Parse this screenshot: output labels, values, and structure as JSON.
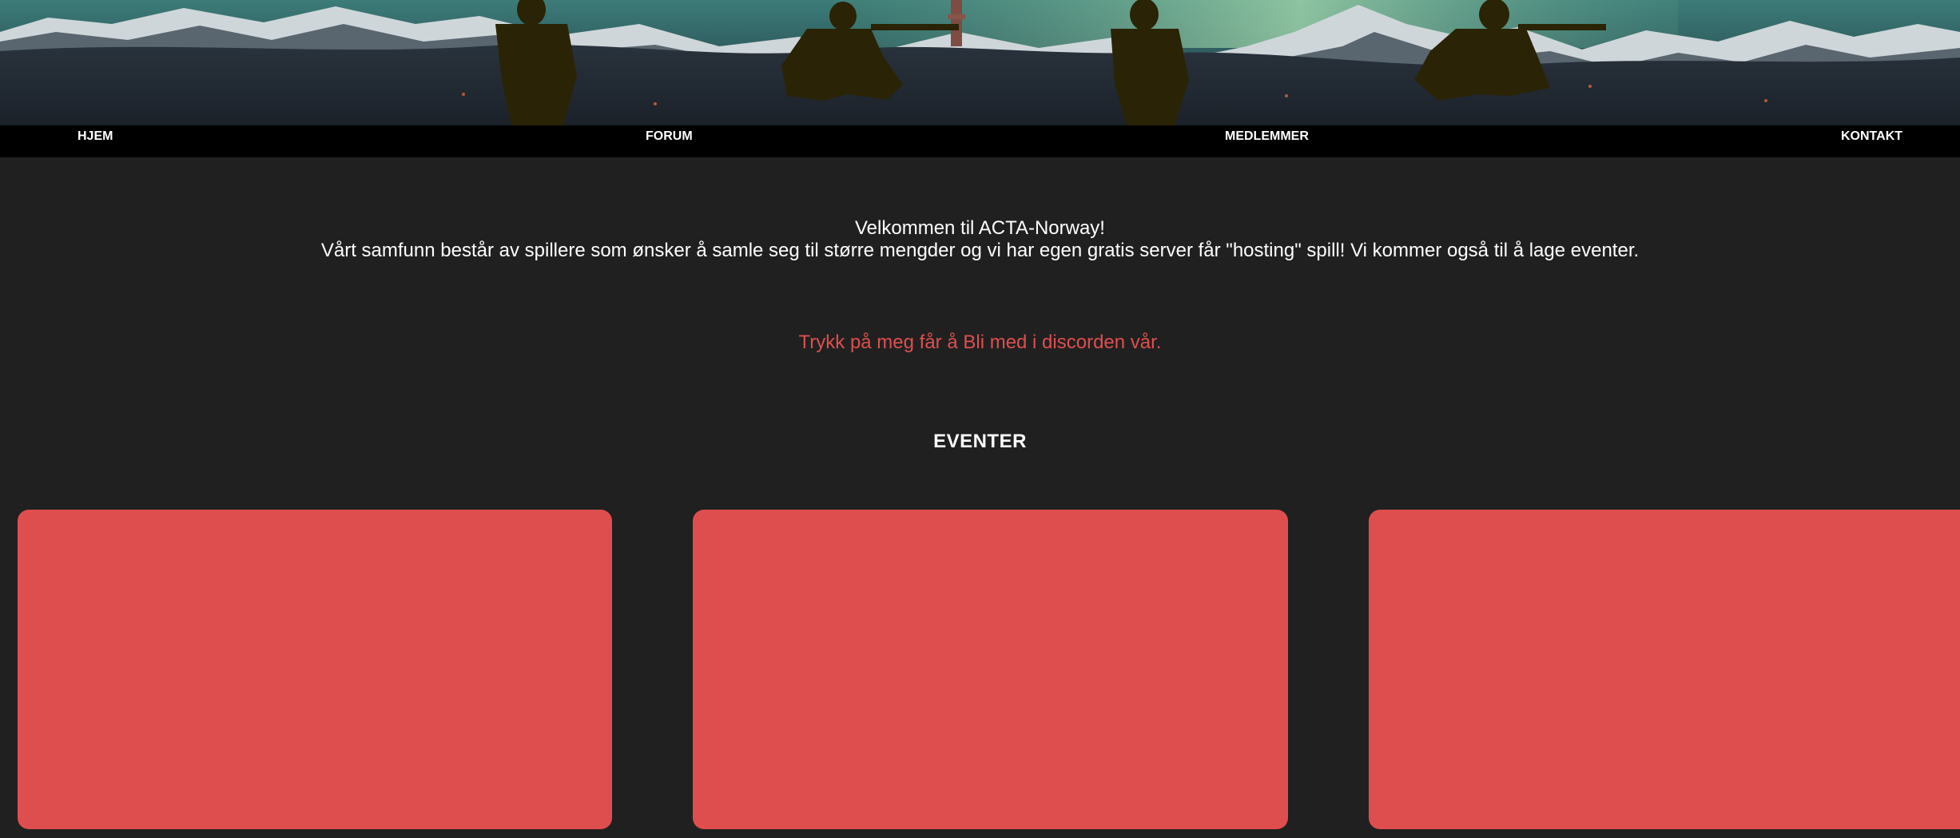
{
  "nav": {
    "items": [
      {
        "label": "HJEM"
      },
      {
        "label": "FORUM"
      },
      {
        "label": "MEDLEMMER"
      },
      {
        "label": "KONTAKT"
      }
    ]
  },
  "intro": {
    "title": "Velkommen til ACTA-Norway!",
    "text": "Vårt samfunn består av spillere som ønsker å samle seg til større mengder og vi har egen gratis server får \"hosting\" spill! Vi kommer også til å lage eventer.",
    "discord_link": "Trykk på meg får å Bli med i discorden vår."
  },
  "events": {
    "heading": "EVENTER",
    "cards": [
      {},
      {},
      {}
    ]
  },
  "colors": {
    "background": "#202020",
    "nav_background": "#000000",
    "accent": "#df4e4e",
    "text": "#ffffff",
    "silhouette": "#2a2306"
  }
}
